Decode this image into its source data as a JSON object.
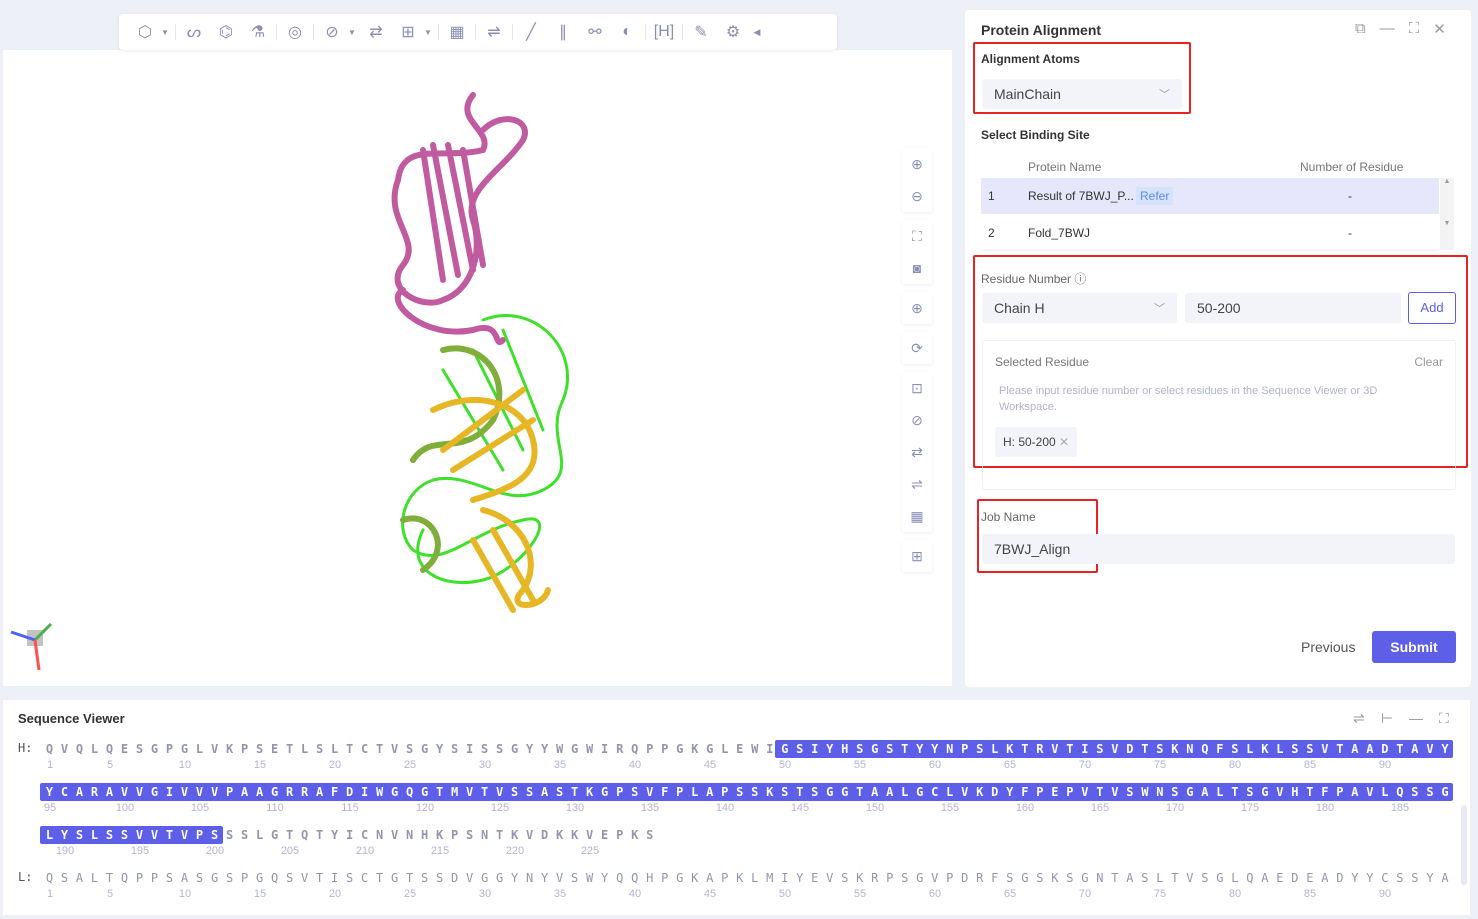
{
  "toolbar": {
    "icons": [
      "cube-icon",
      "ribbon-icon",
      "molecule-icon",
      "flask-icon",
      "target-select-icon",
      "measure-icon",
      "route-icon",
      "bookmark-add-icon",
      "surface-map-icon",
      "align-icon",
      "line-icon",
      "pencil-line-icon",
      "bond-icon",
      "overlap-icon",
      "bracket-h-icon",
      "edit-icon",
      "settings-icon",
      "collapse-icon"
    ]
  },
  "panel": {
    "title": "Protein Alignment",
    "alignment_atoms_label": "Alignment Atoms",
    "alignment_atoms_value": "MainChain",
    "binding_site_label": "Select Binding Site",
    "table": {
      "headers": [
        "Protein Name",
        "Number of Residue"
      ],
      "rows": [
        {
          "index": "1",
          "name": "Result of 7BWJ_P...",
          "badge": "Refer",
          "residues": "-"
        },
        {
          "index": "2",
          "name": "Fold_7BWJ",
          "residues": "-"
        }
      ]
    },
    "residue_number_label": "Residue Number",
    "chain_value": "Chain H",
    "range_value": "50-200",
    "add_label": "Add",
    "selected_residue_label": "Selected Residue",
    "clear_label": "Clear",
    "hint": "Please input residue number or select residues in the Sequence Viewer or 3D Workspace.",
    "tag": "H: 50-200",
    "job_name_label": "Job Name",
    "job_name_value": "7BWJ_Align",
    "previous_label": "Previous",
    "submit_label": "Submit",
    "accent": "#5d5fe8"
  },
  "sequence_viewer": {
    "title": "Sequence Viewer",
    "selection": {
      "chain": "H",
      "from": 50,
      "to": 200
    },
    "lines": [
      {
        "chain": "H",
        "label": "H:",
        "start": 1,
        "residues": "QVQLQESGPGLVKPSETLSLTCTVSGYSISSGYYWGWIRQPPGKGLEWIGSIYHSGSTYYNPSLKTRVTISVDTSKNQFSLKLSSVTAADTAVY"
      },
      {
        "chain": "H",
        "label": "",
        "start": 95,
        "residues": "YCARAVVGIVVVPAAGRRAFDIWGQGTMVTVSSASTKGPSVFPLAPSSKSTSGGTAALGCLVKDYFPEPVTVSWNSGALTSGVHTFPAVLQSSG"
      },
      {
        "chain": "H",
        "label": "",
        "start": 189,
        "residues": "LYSLSSVVTVPSSSLGTQTYICNVNHKPSNTKVDKKVEPKS"
      },
      {
        "chain": "L",
        "label": "L:",
        "start": 1,
        "residues": "QSALTQPPSASGSPGQSVTISCTGTSSDVGGYNYVSWYQQHPGKAPKLMIYEVSKRPSGVPDRFSGSKSGNTASLTVSGLQAEDEADYYCSSYA"
      }
    ]
  }
}
